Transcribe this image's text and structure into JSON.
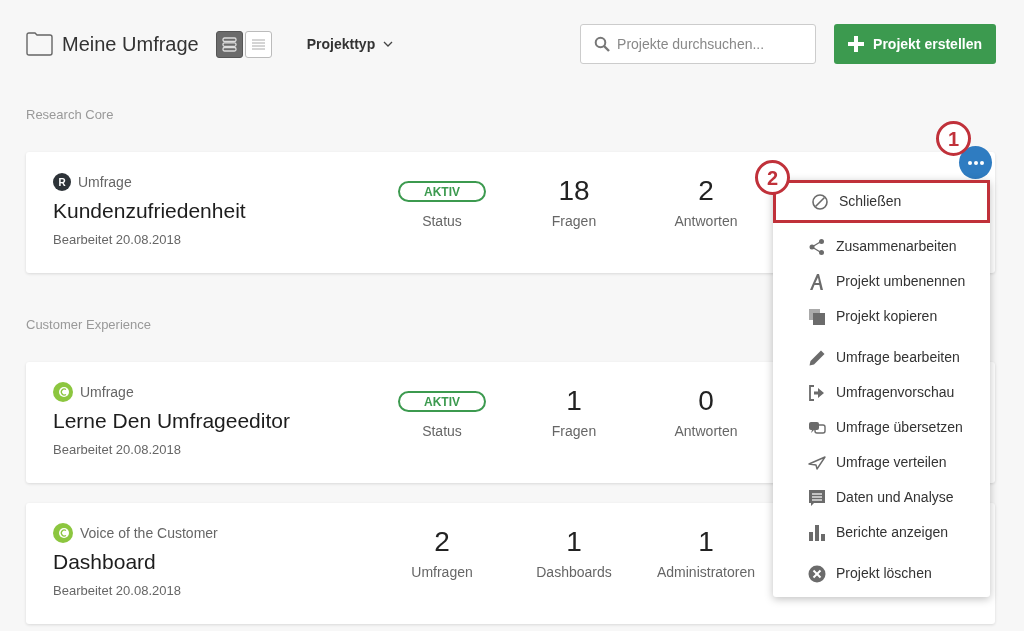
{
  "header": {
    "title": "Meine Umfrage",
    "view_toggle": [
      {
        "selected": true
      },
      {
        "selected": false
      }
    ],
    "filter": "Projekttyp",
    "search": {
      "placeholder": "Projekte durchsuchen..."
    },
    "create_button": "Projekt erstellen"
  },
  "sections": [
    {
      "label": "Research Core",
      "projects": [
        {
          "logo": {
            "kind": "letter",
            "letter": "R"
          },
          "type": "Umfrage",
          "title": "Kundenzufriedenheit",
          "edited": "Bearbeitet 20.08.2018",
          "metrics": [
            {
              "kind": "status",
              "value": "AKTIV",
              "label": "Status"
            },
            {
              "kind": "count",
              "value": "18",
              "label": "Fragen"
            },
            {
              "kind": "count",
              "value": "2",
              "label": "Antworten"
            }
          ]
        }
      ]
    },
    {
      "label": "Customer Experience",
      "projects": [
        {
          "logo": {
            "kind": "ring"
          },
          "type": "Umfrage",
          "title": "Lerne Den Umfrageeditor",
          "edited": "Bearbeitet 20.08.2018",
          "metrics": [
            {
              "kind": "status",
              "value": "AKTIV",
              "label": "Status"
            },
            {
              "kind": "count",
              "value": "1",
              "label": "Fragen"
            },
            {
              "kind": "count",
              "value": "0",
              "label": "Antworten"
            }
          ]
        },
        {
          "logo": {
            "kind": "ring"
          },
          "type": "Voice of the Customer",
          "title": "Dashboard",
          "edited": "Bearbeitet 20.08.2018",
          "metrics": [
            {
              "kind": "count",
              "value": "2",
              "label": "Umfragen"
            },
            {
              "kind": "count",
              "value": "1",
              "label": "Dashboards"
            },
            {
              "kind": "count",
              "value": "1",
              "label": "Administratoren"
            }
          ]
        }
      ]
    }
  ],
  "menu": {
    "groups": [
      [
        {
          "label": "Schließen",
          "highlighted": true
        }
      ],
      [
        {
          "label": "Zusammenarbeiten",
          "highlighted": false
        },
        {
          "label": "Projekt umbenennen",
          "highlighted": false
        },
        {
          "label": "Projekt kopieren",
          "highlighted": false
        }
      ],
      [
        {
          "label": "Umfrage bearbeiten",
          "highlighted": false
        },
        {
          "label": "Umfragenvorschau",
          "highlighted": false
        },
        {
          "label": "Umfrage übersetzen",
          "highlighted": false
        },
        {
          "label": "Umfrage verteilen",
          "highlighted": false
        },
        {
          "label": "Daten und Analyse",
          "highlighted": false
        },
        {
          "label": "Berichte anzeigen",
          "highlighted": false
        }
      ],
      [
        {
          "label": "Projekt löschen",
          "highlighted": false
        }
      ]
    ]
  },
  "callouts": [
    "1",
    "2"
  ]
}
